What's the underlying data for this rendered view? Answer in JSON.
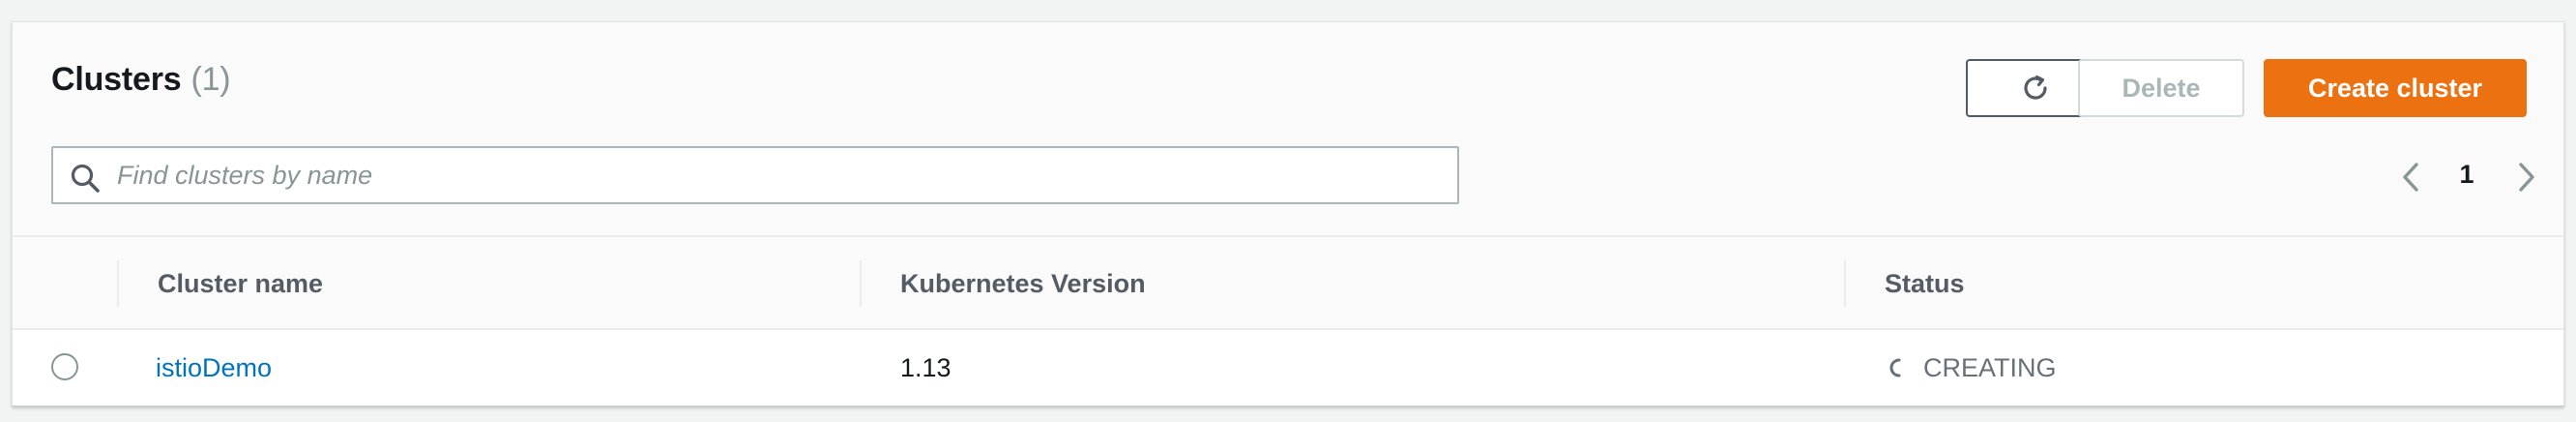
{
  "header": {
    "title": "Clusters",
    "count": "(1)"
  },
  "toolbar": {
    "refresh_icon": "refresh-icon",
    "delete_label": "Delete",
    "create_label": "Create cluster"
  },
  "search": {
    "placeholder": "Find clusters by name",
    "value": "",
    "icon": "search-icon"
  },
  "pagination": {
    "page": "1"
  },
  "table": {
    "columns": [
      "Cluster name",
      "Kubernetes Version",
      "Status"
    ],
    "rows": [
      {
        "name": "istioDemo",
        "version": "1.13",
        "status": "CREATING"
      }
    ]
  },
  "colors": {
    "accent": "#ec7211",
    "link": "#0073bb",
    "text": "#16191f"
  }
}
